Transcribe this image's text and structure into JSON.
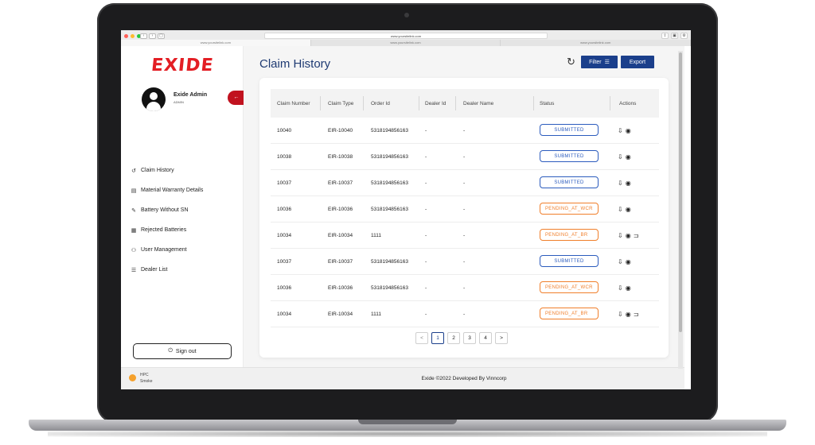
{
  "browser": {
    "url": "www.yoursitelink.com",
    "tabs": [
      "www.yoursitelink.com",
      "www.yoursitelink.com",
      "www.yoursitelink.com"
    ]
  },
  "brand": {
    "logo_text": "EXIDE",
    "color": "#e31e24"
  },
  "profile": {
    "name": "Exide Admin",
    "role": "ADMIN"
  },
  "sidebar": {
    "items": [
      {
        "label": "Claim History",
        "icon": "history-icon",
        "glyph": "↺"
      },
      {
        "label": "Material Warranty Details",
        "icon": "document-icon",
        "glyph": "▤"
      },
      {
        "label": "Battery Without SN",
        "icon": "edit-icon",
        "glyph": "✎"
      },
      {
        "label": "Rejected Batteries",
        "icon": "list-icon",
        "glyph": "▦"
      },
      {
        "label": "User Management",
        "icon": "users-icon",
        "glyph": "⚇"
      },
      {
        "label": "Dealer List",
        "icon": "menu-list-icon",
        "glyph": "☰"
      }
    ],
    "signout_label": "Sign out",
    "footer_line1": "HPC",
    "footer_line2": "Smoke"
  },
  "header": {
    "title": "Claim History",
    "filter_label": "Filter",
    "export_label": "Export"
  },
  "table": {
    "columns": [
      "Claim Number",
      "Claim Type",
      "Order Id",
      "Dealer Id",
      "Dealer Name",
      "Status",
      "Actions"
    ],
    "rows": [
      {
        "claim_number": "10040",
        "claim_type": "EIR-10040",
        "order_id": "5318194856163",
        "dealer_id": "-",
        "dealer_name": "-",
        "status": "SUBMITTED",
        "status_kind": "submitted",
        "has_return": false
      },
      {
        "claim_number": "10038",
        "claim_type": "EIR-10038",
        "order_id": "5318194856163",
        "dealer_id": "-",
        "dealer_name": "-",
        "status": "SUBMITTED",
        "status_kind": "submitted",
        "has_return": false
      },
      {
        "claim_number": "10037",
        "claim_type": "EIR-10037",
        "order_id": "5318194856163",
        "dealer_id": "-",
        "dealer_name": "-",
        "status": "SUBMITTED",
        "status_kind": "submitted",
        "has_return": false
      },
      {
        "claim_number": "10036",
        "claim_type": "EIR-10036",
        "order_id": "5318194856163",
        "dealer_id": "-",
        "dealer_name": "-",
        "status": "PENDING_AT_WCR",
        "status_kind": "pending",
        "has_return": false
      },
      {
        "claim_number": "10034",
        "claim_type": "EIR-10034",
        "order_id": "1111",
        "dealer_id": "-",
        "dealer_name": "-",
        "status": "PENDING_AT_BR",
        "status_kind": "pending",
        "has_return": true
      },
      {
        "claim_number": "10037",
        "claim_type": "EIR-10037",
        "order_id": "5318194856163",
        "dealer_id": "-",
        "dealer_name": "-",
        "status": "SUBMITTED",
        "status_kind": "submitted",
        "has_return": false
      },
      {
        "claim_number": "10036",
        "claim_type": "EIR-10036",
        "order_id": "5318194856163",
        "dealer_id": "-",
        "dealer_name": "-",
        "status": "PENDING_AT_WCR",
        "status_kind": "pending",
        "has_return": false
      },
      {
        "claim_number": "10034",
        "claim_type": "EIR-10034",
        "order_id": "1111",
        "dealer_id": "-",
        "dealer_name": "-",
        "status": "PENDING_AT_BR",
        "status_kind": "pending",
        "has_return": true
      }
    ]
  },
  "pagination": {
    "prev": "<",
    "pages": [
      "1",
      "2",
      "3",
      "4"
    ],
    "active": "1",
    "next": ">"
  },
  "footer": {
    "text": "Exide ©2022 Developed By Vinncorp"
  },
  "colors": {
    "primary": "#1b3f8b",
    "submitted": "#2b5bbd",
    "pending": "#f07f2b",
    "collapse": "#c1121f"
  }
}
